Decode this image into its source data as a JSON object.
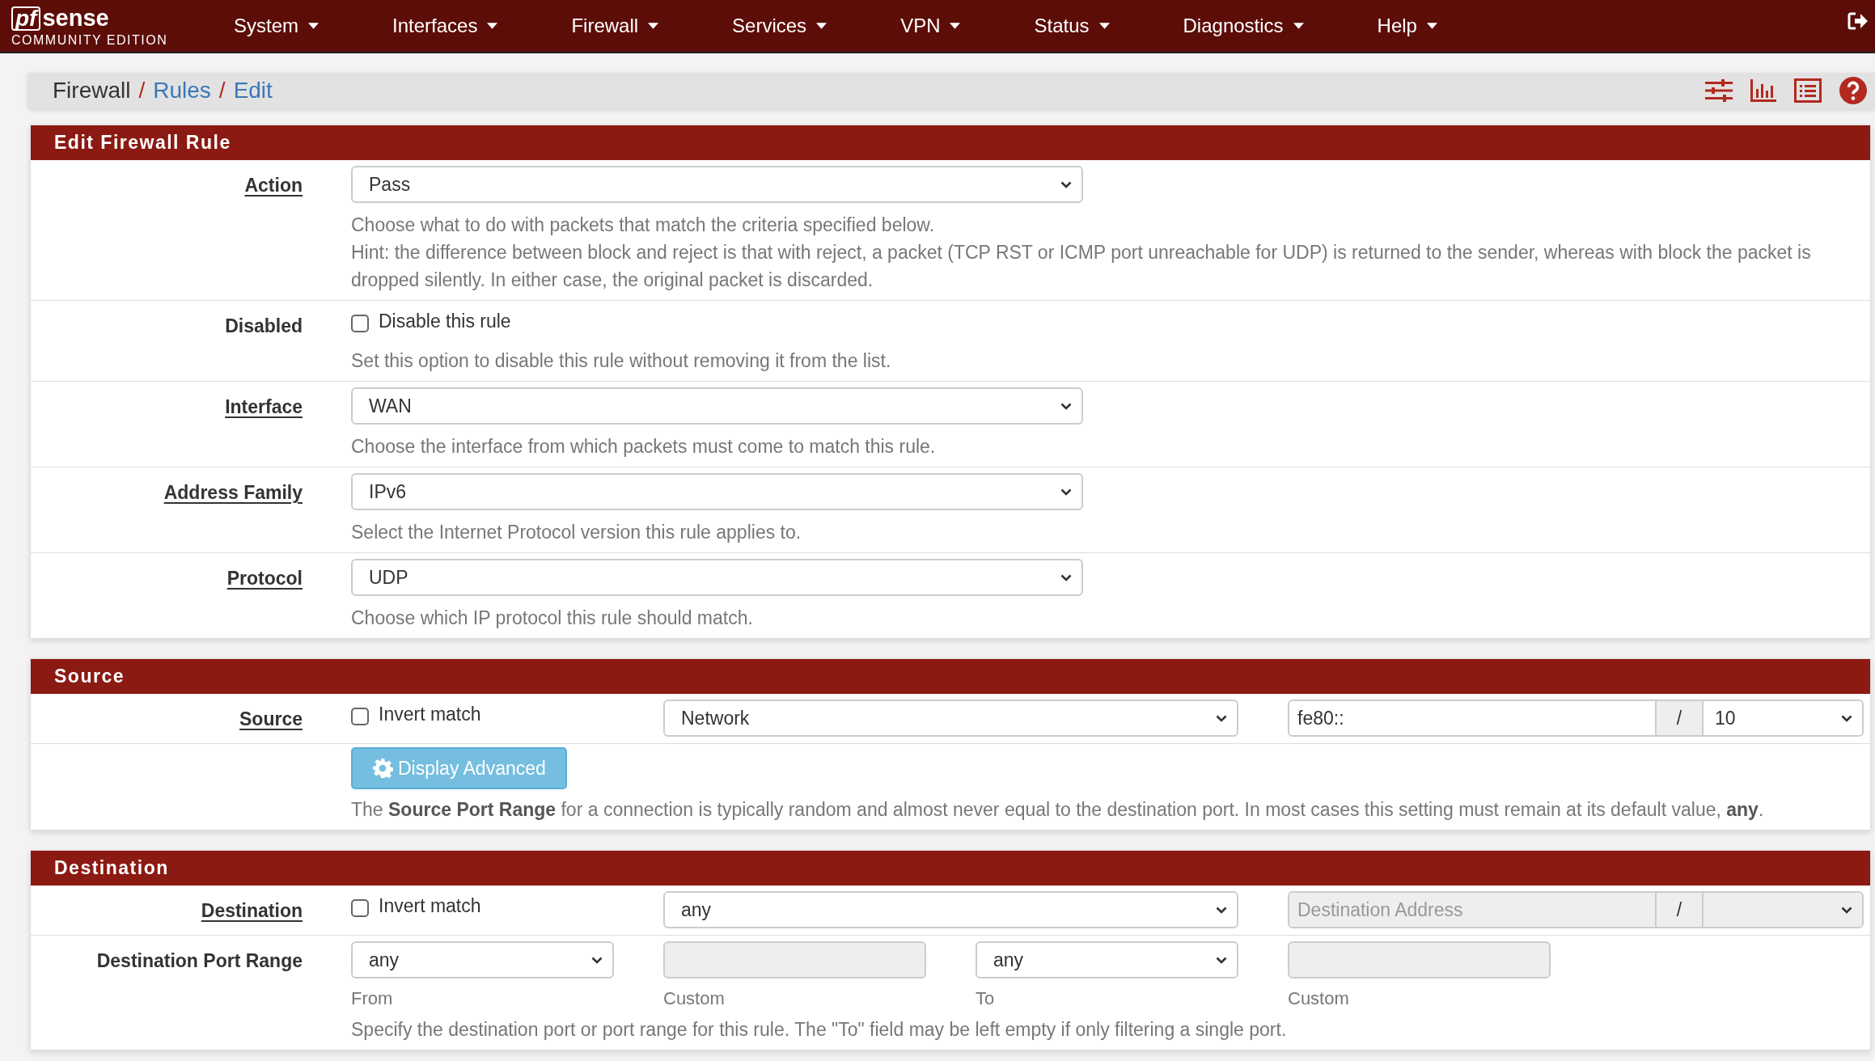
{
  "nav": {
    "brand_mark": "pf",
    "brand": "sense",
    "edition": "COMMUNITY EDITION",
    "menus": [
      "System",
      "Interfaces",
      "Firewall",
      "Services",
      "VPN",
      "Status",
      "Diagnostics",
      "Help"
    ]
  },
  "breadcrumb": [
    {
      "label": "Firewall",
      "link": false
    },
    {
      "separator": "/",
      "label": "Rules",
      "link": true
    },
    {
      "separator": "/",
      "label": "Edit",
      "link": true
    }
  ],
  "sections": [
    {
      "title": "Edit Firewall Rule",
      "rows": [
        {
          "kind": "select",
          "label": "Action",
          "link": true,
          "value": "Pass",
          "help": [
            "Choose what to do with packets that match the criteria specified below.",
            "Hint: the difference between block and reject is that with reject, a packet (TCP RST or ICMP port unreachable for UDP) is returned to the sender, whereas with block the packet is dropped silently. In either case, the original packet is discarded."
          ]
        },
        {
          "kind": "checkbox",
          "label": "Disabled",
          "link": false,
          "text": "Disable this rule",
          "checked": false,
          "help": [
            "Set this option to disable this rule without removing it from the list."
          ]
        },
        {
          "kind": "select",
          "label": "Interface",
          "link": true,
          "value": "WAN",
          "help": [
            "Choose the interface from which packets must come to match this rule."
          ]
        },
        {
          "kind": "select",
          "label": "Address Family",
          "link": true,
          "value": "IPv6",
          "help": [
            "Select the Internet Protocol version this rule applies to."
          ]
        },
        {
          "kind": "select",
          "label": "Protocol",
          "link": true,
          "value": "UDP",
          "help": [
            "Choose which IP protocol this rule should match."
          ]
        }
      ]
    },
    {
      "title": "Source",
      "rows": [
        {
          "kind": "address",
          "label": "Source",
          "link": true,
          "invert": {
            "text": "Invert match",
            "checked": false
          },
          "type": "Network",
          "address": {
            "value": "fe80::",
            "disabled": false
          },
          "slash": "/",
          "mask": "10"
        },
        {
          "kind": "advanced",
          "button": "Display Advanced",
          "help": [
            "The **Source Port Range** for a connection is typically random and almost never equal to the destination port. In most cases this setting must remain at its default value, **any**."
          ]
        }
      ]
    },
    {
      "title": "Destination",
      "rows": [
        {
          "kind": "address",
          "label": "Destination",
          "link": true,
          "invert": {
            "text": "Invert match",
            "checked": false
          },
          "type": "any",
          "address": {
            "placeholder": "Destination Address",
            "disabled": true
          },
          "slash": "/"
        },
        {
          "kind": "portrange",
          "label": "Destination Port Range",
          "link": false,
          "items": [
            {
              "kind": "select",
              "value": "any",
              "caption": "From"
            },
            {
              "kind": "field",
              "caption": "Custom"
            },
            {
              "kind": "select",
              "value": "any",
              "caption": "To"
            },
            {
              "kind": "field",
              "caption": "Custom"
            }
          ],
          "help": [
            "Specify the destination port or port range for this rule. The \"To\" field may be left empty if only filtering a single port."
          ]
        }
      ]
    }
  ]
}
